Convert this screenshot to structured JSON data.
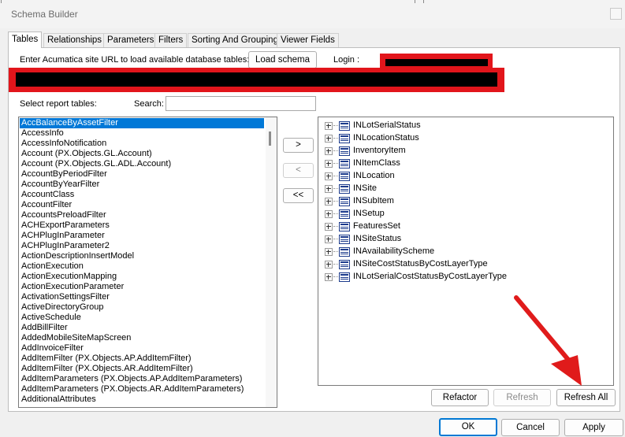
{
  "window": {
    "title": "Schema Builder"
  },
  "tabs": [
    {
      "label": "Tables",
      "active": true
    },
    {
      "label": "Relationships"
    },
    {
      "label": "Parameters"
    },
    {
      "label": "Filters"
    },
    {
      "label": "Sorting And Grouping"
    },
    {
      "label": "Viewer Fields"
    }
  ],
  "connection": {
    "url_label": "Enter Acumatica site URL to load available database tables:",
    "load_button": "Load schema",
    "login_label": "Login :"
  },
  "tables": {
    "select_label": "Select report tables:",
    "search_label": "Search:",
    "search_value": "",
    "items": [
      "AccBalanceByAssetFilter",
      "AccessInfo",
      "AccessInfoNotification",
      "Account (PX.Objects.GL.Account)",
      "Account (PX.Objects.GL.ADL.Account)",
      "AccountByPeriodFilter",
      "AccountByYearFilter",
      "AccountClass",
      "AccountFilter",
      "AccountsPreloadFilter",
      "ACHExportParameters",
      "ACHPlugInParameter",
      "ACHPlugInParameter2",
      "ActionDescriptionInsertModel",
      "ActionExecution",
      "ActionExecutionMapping",
      "ActionExecutionParameter",
      "ActivationSettingsFilter",
      "ActiveDirectoryGroup",
      "ActiveSchedule",
      "AddBillFilter",
      "AddedMobileSiteMapScreen",
      "AddInvoiceFilter",
      "AddItemFilter (PX.Objects.AP.AddItemFilter)",
      "AddItemFilter (PX.Objects.AR.AddItemFilter)",
      "AddItemParameters (PX.Objects.AP.AddItemParameters)",
      "AddItemParameters (PX.Objects.AR.AddItemParameters)",
      "AdditionalAttributes"
    ],
    "selected_index": 0
  },
  "move_buttons": {
    "add": ">",
    "remove": "<",
    "remove_all": "<<"
  },
  "selected_tables": [
    "INLotSerialStatus",
    "INLocationStatus",
    "InventoryItem",
    "INItemClass",
    "INLocation",
    "INSite",
    "INSubItem",
    "INSetup",
    "FeaturesSet",
    "INSiteStatus",
    "INAvailabilityScheme",
    "INSiteCostStatusByCostLayerType",
    "INLotSerialCostStatusByCostLayerType"
  ],
  "tree_buttons": {
    "refactor": "Refactor",
    "refresh": "Refresh",
    "refresh_all": "Refresh All"
  },
  "dialog_buttons": {
    "ok": "OK",
    "cancel": "Cancel",
    "apply": "Apply"
  },
  "colors": {
    "redaction_border": "#e2151b",
    "selection": "#0078d7",
    "annotation_arrow": "#e01b1b"
  }
}
